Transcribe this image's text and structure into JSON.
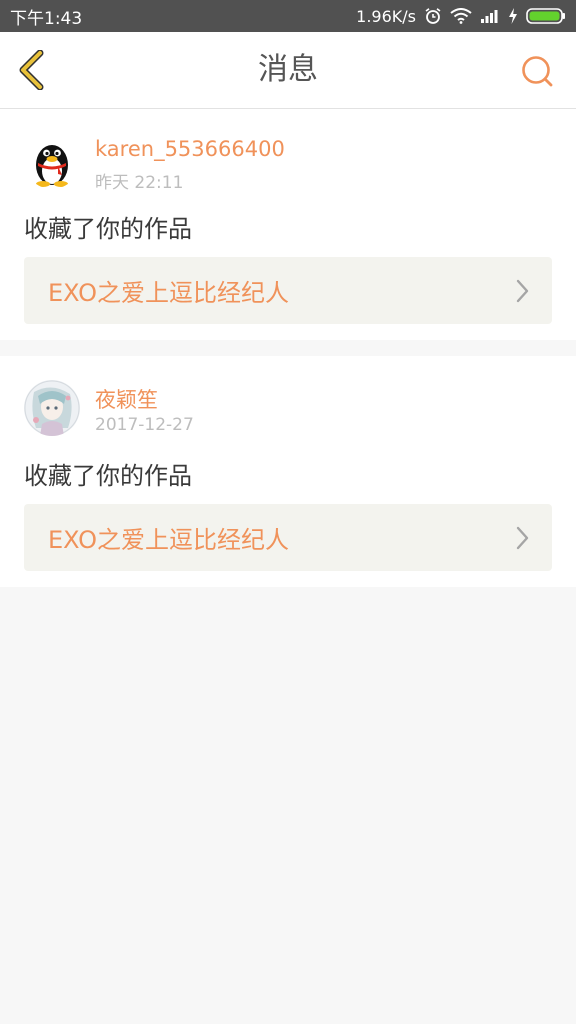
{
  "status_bar": {
    "time": "下午1:43",
    "network_speed": "1.96K/s",
    "icons": [
      "alarm-icon",
      "wifi-icon",
      "signal-icon",
      "charging-icon",
      "battery-icon"
    ]
  },
  "header": {
    "title": "消息",
    "back_icon": "chevron-left-icon",
    "search_icon": "search-icon"
  },
  "colors": {
    "accent": "#f0925a",
    "back_arrow": "#e8c13a",
    "card_link_bg": "#f3f3ee",
    "page_bg": "#f7f7f7"
  },
  "messages": [
    {
      "username": "karen_553666400",
      "time": "昨天 22:11",
      "action": "收藏了你的作品",
      "work_title": "EXO之爱上逗比经纪人",
      "avatar": "qq-penguin-avatar"
    },
    {
      "username": "夜颖笙",
      "time": "2017-12-27",
      "action": "收藏了你的作品",
      "work_title": "EXO之爱上逗比经纪人",
      "avatar": "anime-girl-avatar"
    }
  ]
}
